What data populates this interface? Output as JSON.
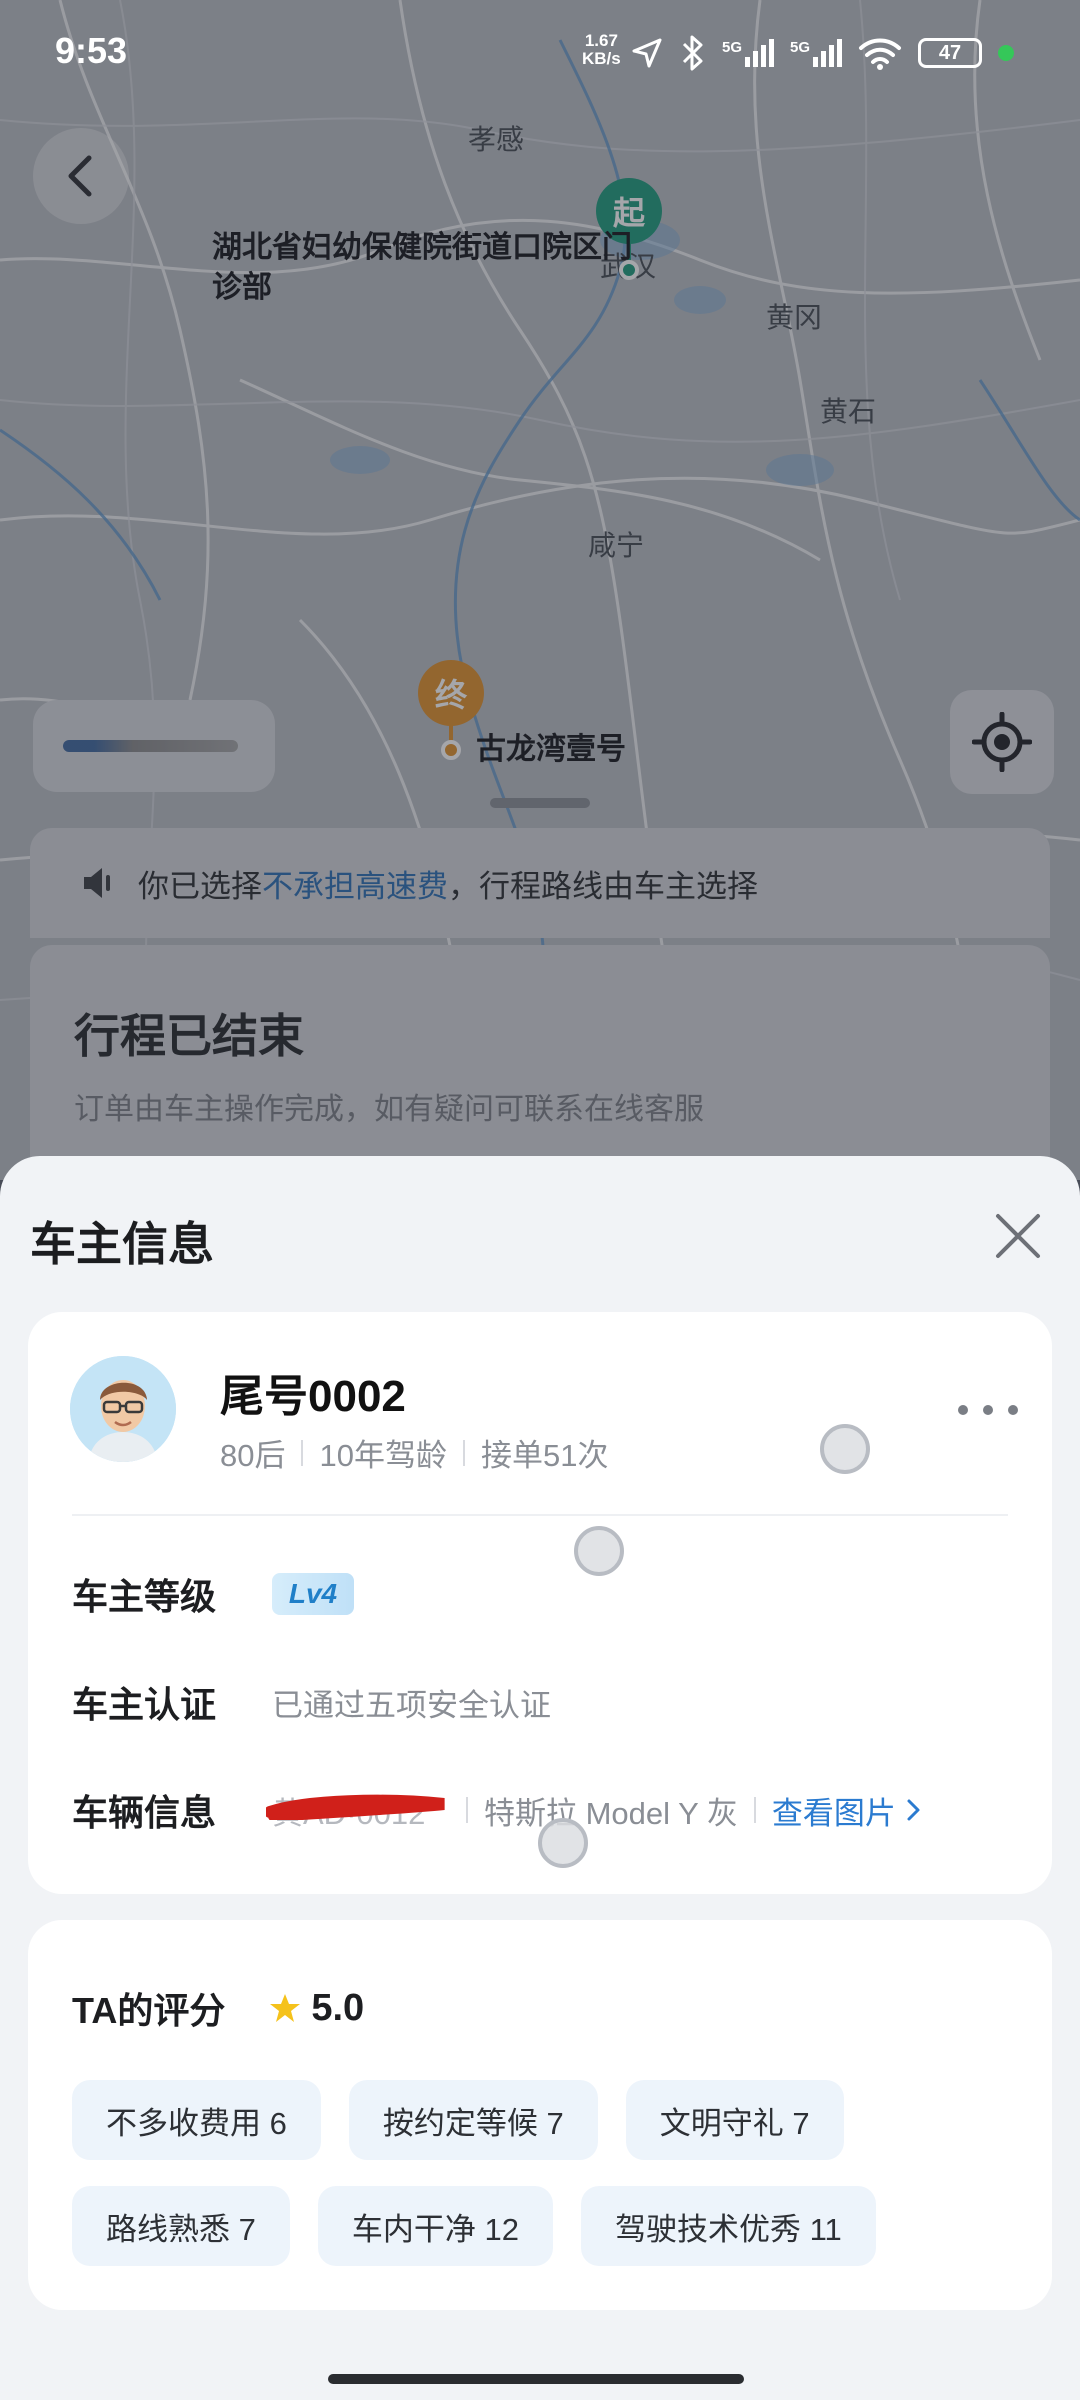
{
  "status_bar": {
    "time": "9:53",
    "net_speed_value": "1.67",
    "net_speed_unit": "KB/s",
    "signal_1": "5G",
    "signal_2": "5G",
    "battery": "47",
    "icons": [
      "location-arrow-icon",
      "bluetooth-icon",
      "signal-icon",
      "wifi-icon",
      "battery-icon"
    ]
  },
  "map": {
    "labels": {
      "xiaogan": "孝感",
      "huanggang": "黄冈",
      "huangshi": "黄石",
      "xianning": "咸宁",
      "wuhan": "武汉"
    },
    "start_pin": "起",
    "end_pin": "终",
    "start_place": "湖北省妇幼保健院街道口院区门诊部",
    "end_place": "古龙湾壹号",
    "colors": {
      "start": "#1e9c7c",
      "end": "#e0922c"
    }
  },
  "notice": {
    "prefix": "你已选择",
    "link": "不承担高速费",
    "suffix": "，行程路线由车主选择"
  },
  "trip": {
    "title": "行程已结束",
    "subtitle": "订单由车主操作完成，如有疑问可联系在线客服"
  },
  "sheet": {
    "title": "车主信息",
    "driver": {
      "name": "尾号0002",
      "meta": [
        "80后",
        "10年驾龄",
        "接单51次"
      ]
    },
    "level": {
      "label": "车主等级",
      "badge": "Lv4"
    },
    "certification": {
      "label": "车主认证",
      "value": "已通过五项安全认证"
    },
    "vehicle": {
      "label": "车辆信息",
      "plate": "黄AD·0012",
      "model": "特斯拉 Model Y 灰",
      "link": "查看图片"
    },
    "rating": {
      "title": "TA的评分",
      "score": "5.0",
      "tags": [
        "不多收费用 6",
        "按约定等候 7",
        "文明守礼 7",
        "路线熟悉 7",
        "车内干净 12",
        "驾驶技术优秀 11"
      ]
    }
  }
}
